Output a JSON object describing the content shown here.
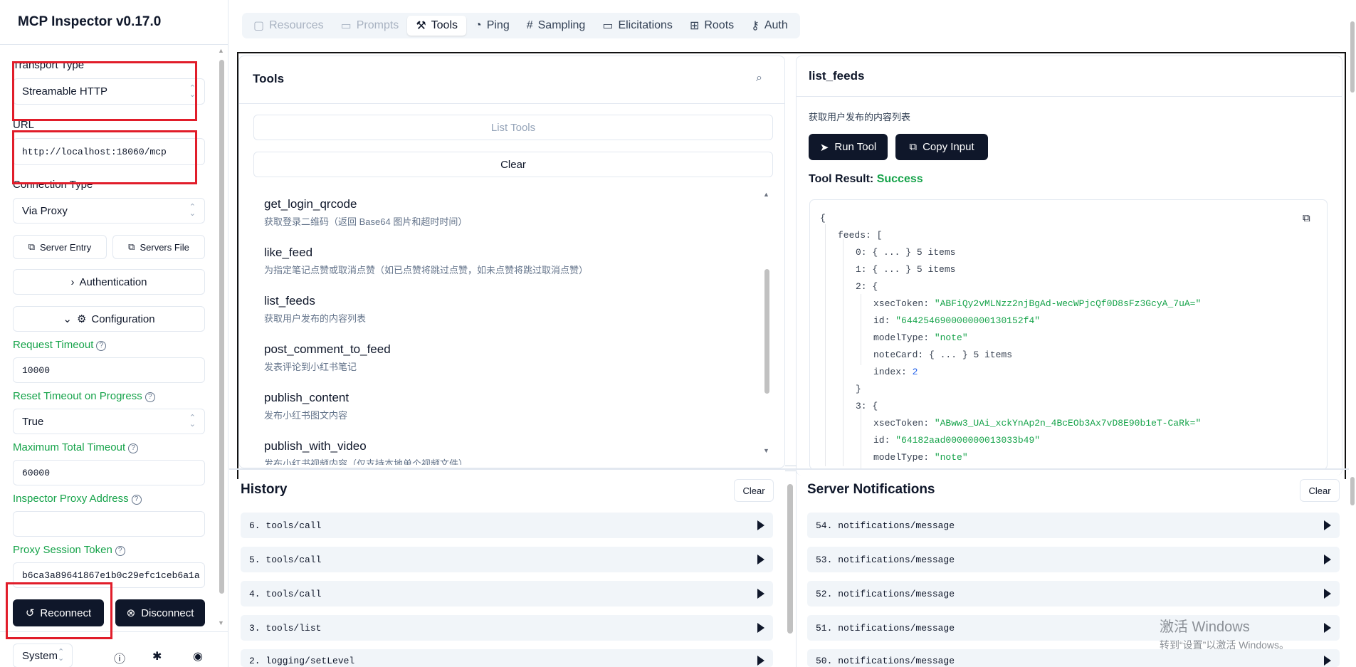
{
  "app_title": "MCP Inspector v0.17.0",
  "sidebar": {
    "transport_label": "Transport Type",
    "transport_value": "Streamable HTTP",
    "url_label": "URL",
    "url_value": "http://localhost:18060/mcp",
    "connection_label": "Connection Type",
    "connection_value": "Via Proxy",
    "server_entry": "Server Entry",
    "servers_file": "Servers File",
    "authentication": "Authentication",
    "configuration": "Configuration",
    "request_timeout_label": "Request Timeout",
    "request_timeout_value": "10000",
    "reset_timeout_label": "Reset Timeout on Progress",
    "reset_timeout_value": "True",
    "max_timeout_label": "Maximum Total Timeout",
    "max_timeout_value": "60000",
    "proxy_address_label": "Inspector Proxy Address",
    "proxy_address_value": "",
    "proxy_token_label": "Proxy Session Token",
    "proxy_token_value": "b6ca3a89641867e1b0c29efc1ceb6a1a",
    "reconnect": "Reconnect",
    "disconnect": "Disconnect",
    "theme_value": "System"
  },
  "tabs": [
    {
      "label": "Resources",
      "icon": "file-icon"
    },
    {
      "label": "Prompts",
      "icon": "message-icon"
    },
    {
      "label": "Tools",
      "icon": "hammer-icon"
    },
    {
      "label": "Ping",
      "icon": "bell-icon"
    },
    {
      "label": "Sampling",
      "icon": "hash-icon"
    },
    {
      "label": "Elicitations",
      "icon": "message-square-icon"
    },
    {
      "label": "Roots",
      "icon": "folder-tree-icon"
    },
    {
      "label": "Auth",
      "icon": "key-icon"
    }
  ],
  "tools_panel": {
    "title": "Tools",
    "list_tools": "List Tools",
    "clear": "Clear",
    "tools": [
      {
        "name": "get_login_qrcode",
        "desc": "获取登录二维码（返回 Base64 图片和超时时间）"
      },
      {
        "name": "like_feed",
        "desc": "为指定笔记点赞或取消点赞（如已点赞将跳过点赞，如未点赞将跳过取消点赞）"
      },
      {
        "name": "list_feeds",
        "desc": "获取用户发布的内容列表"
      },
      {
        "name": "post_comment_to_feed",
        "desc": "发表评论到小红书笔记"
      },
      {
        "name": "publish_content",
        "desc": "发布小红书图文内容"
      },
      {
        "name": "publish_with_video",
        "desc": "发布小红书视频内容（仅支持本地单个视频文件）"
      }
    ]
  },
  "detail_panel": {
    "title": "list_feeds",
    "desc": "获取用户发布的内容列表",
    "run_tool": "Run Tool",
    "copy_input": "Copy Input",
    "result_label": "Tool Result:",
    "result_status": "Success",
    "status_color": "#16a34a",
    "json": {
      "open_brace": "{",
      "feeds_key": "feeds:",
      "feeds_open": "[",
      "item0_key": "0:",
      "item0_val": "{ ... }",
      "item0_count": "5 items",
      "item1_key": "1:",
      "item1_val": "{ ... }",
      "item1_count": "5 items",
      "item2_key": "2:",
      "item2_open": "{",
      "i2_xsec_key": "xsecToken:",
      "i2_xsec_val": "\"ABFiQy2vMLNzz2njBgAd-wecWPjcQf0D8sFz3GcyA_7uA=\"",
      "i2_id_key": "id:",
      "i2_id_val": "\"6442546900000000130152f4\"",
      "i2_model_key": "modelType:",
      "i2_model_val": "\"note\"",
      "i2_card_key": "noteCard:",
      "i2_card_val": "{ ... }",
      "i2_card_count": "5 items",
      "i2_index_key": "index:",
      "i2_index_val": "2",
      "item2_close": "}",
      "item3_key": "3:",
      "item3_open": "{",
      "i3_xsec_key": "xsecToken:",
      "i3_xsec_val": "\"ABww3_UAi_xckYnAp2n_4BcEOb3Ax7vD8E90b1eT-CaRk=\"",
      "i3_id_key": "id:",
      "i3_id_val": "\"64182aad0000000013033b49\"",
      "i3_model_key": "modelType:",
      "i3_model_val": "\"note\""
    }
  },
  "history": {
    "title": "History",
    "clear": "Clear",
    "items": [
      "6. tools/call",
      "5. tools/call",
      "4. tools/call",
      "3. tools/list",
      "2. logging/setLevel"
    ]
  },
  "notifications": {
    "title": "Server Notifications",
    "clear": "Clear",
    "items": [
      "54. notifications/message",
      "53. notifications/message",
      "52. notifications/message",
      "51. notifications/message",
      "50. notifications/message"
    ]
  },
  "watermark": {
    "line1": "激活 Windows",
    "line2": "转到“设置”以激活 Windows。"
  }
}
